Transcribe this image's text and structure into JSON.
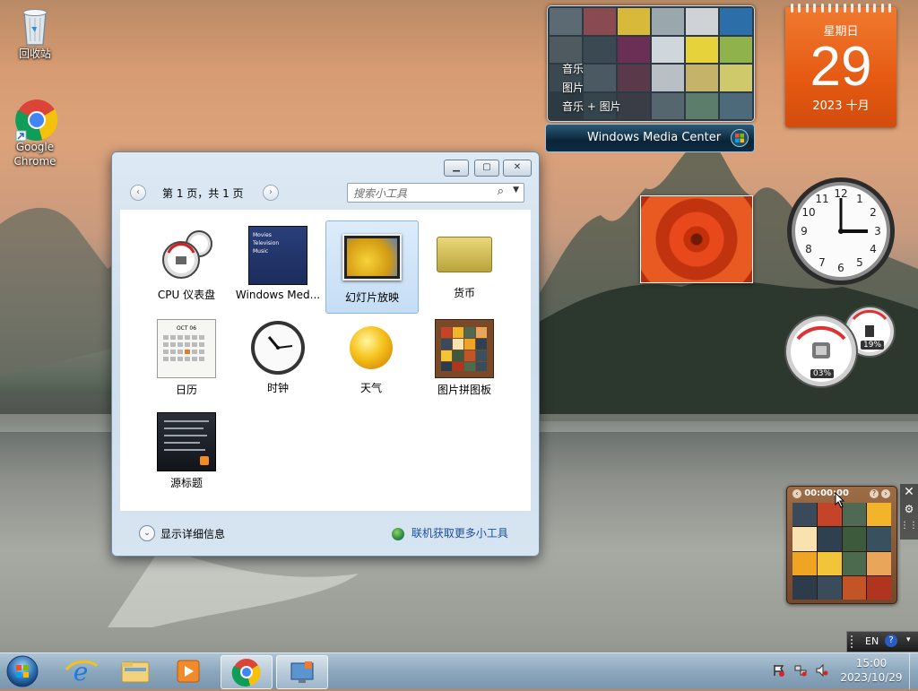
{
  "desktop": {
    "icons": [
      {
        "label": "回收站"
      },
      {
        "label": "Google Chrome"
      }
    ]
  },
  "wmc": {
    "menu": [
      "音乐",
      "图片",
      "音乐 + 图片"
    ],
    "bar_label": "Windows Media Center"
  },
  "calendar": {
    "weekday": "星期日",
    "day": "29",
    "month_year": "2023 十月"
  },
  "gadgets_window": {
    "pager_text": "第 1 页，共 1 页",
    "search_placeholder": "搜索小工具",
    "items": [
      {
        "label": "CPU 仪表盘"
      },
      {
        "label": "Windows Med..."
      },
      {
        "label": "幻灯片放映"
      },
      {
        "label": "货币"
      },
      {
        "label": "日历"
      },
      {
        "label": "时钟"
      },
      {
        "label": "天气"
      },
      {
        "label": "图片拼图板"
      },
      {
        "label": "源标题"
      }
    ],
    "wmc_thumb_lines": [
      "Movies",
      "Television",
      "Music"
    ],
    "calendar_thumb_month": "OCT 06",
    "details_label": "显示详细信息",
    "online_link": "联机获取更多小工具"
  },
  "meter": {
    "cpu": "03%",
    "mem": "19%"
  },
  "puzzle": {
    "timer": "00:00:00"
  },
  "language_bar": {
    "lang": "EN"
  },
  "taskbar": {
    "time": "15:00",
    "date": "2023/10/29"
  },
  "colors": {
    "calendar_orange": "#e65a12",
    "link_blue": "#1a4fa0"
  }
}
